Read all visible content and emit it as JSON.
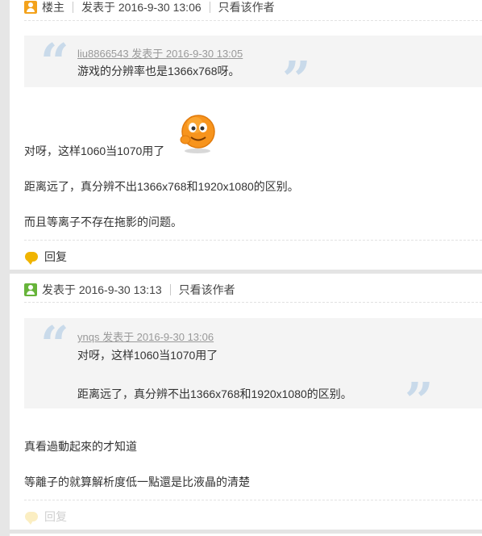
{
  "post1": {
    "author_label": "楼主",
    "posted_at": "发表于 2016-9-30 13:06",
    "only_author_link": "只看该作者",
    "quote": {
      "meta": "liu8866543 发表于 2016-9-30 13:05",
      "lines": [
        "游戏的分辨率也是1366x768呀。"
      ]
    },
    "paragraphs": [
      "对呀，这样1060当1070用了",
      "距离远了，真分辨不出1366x768和1920x1080的区别。",
      "而且等离子不存在拖影的问题。"
    ],
    "reply_label": "回复",
    "emoji_icon": "smiley-emoji"
  },
  "post2": {
    "posted_at": "发表于 2016-9-30 13:13",
    "only_author_link": "只看该作者",
    "quote": {
      "meta": "ynqs 发表于 2016-9-30 13:06",
      "lines": [
        "对呀，这样1060当1070用了",
        "距离远了，真分辨不出1366x768和1920x1080的区别。"
      ]
    },
    "paragraphs": [
      "真看過動起來的才知道",
      "等離子的就算解析度低一點還是比液晶的清楚"
    ],
    "reply_label": "回复"
  },
  "colors": {
    "quote_bg": "#f4f4f4",
    "quote_mark": "#c9daea",
    "reply_icon": "#f0b400",
    "badge_owner": "#f3a21b",
    "badge_user": "#67b43a"
  }
}
